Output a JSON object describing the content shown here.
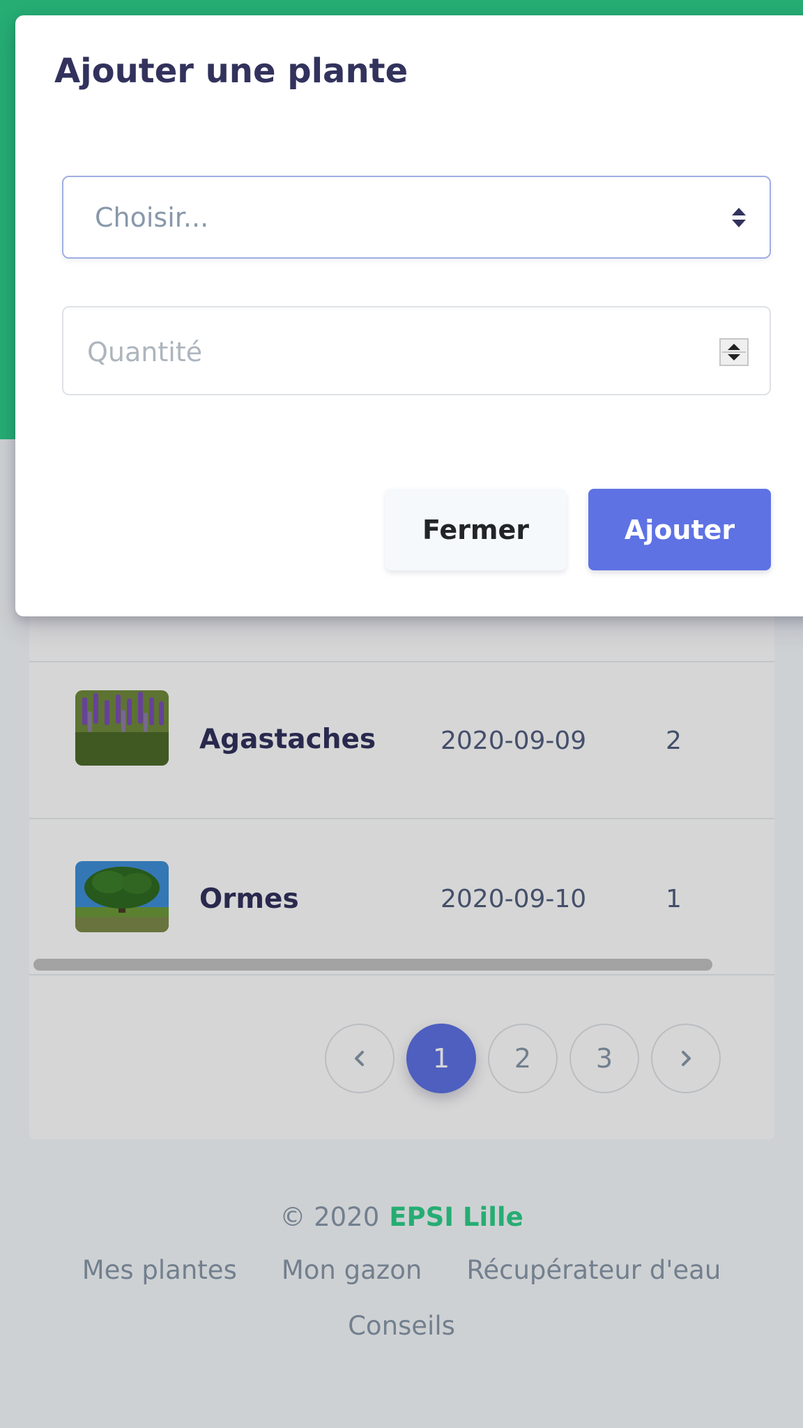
{
  "modal": {
    "title": "Ajouter une plante",
    "select_placeholder": "Choisir...",
    "quantity_placeholder": "Quantité",
    "close_label": "Fermer",
    "submit_label": "Ajouter"
  },
  "table": {
    "rows": [
      {
        "name": "Agastaches",
        "date": "2020-09-09",
        "quantity": "2"
      },
      {
        "name": "Ormes",
        "date": "2020-09-10",
        "quantity": "1"
      }
    ]
  },
  "pagination": {
    "prev_icon": "chevron-left-icon",
    "pages": [
      "1",
      "2",
      "3"
    ],
    "active_page": "1",
    "next_icon": "chevron-right-icon"
  },
  "footer": {
    "copyright": "© 2020",
    "brand": "EPSI Lille",
    "links": [
      "Mes plantes",
      "Mon gazon",
      "Récupérateur d'eau",
      "Conseils"
    ]
  },
  "colors": {
    "header_green": "#2dce89",
    "primary": "#5e72e4",
    "brand_text": "#2dce89"
  }
}
